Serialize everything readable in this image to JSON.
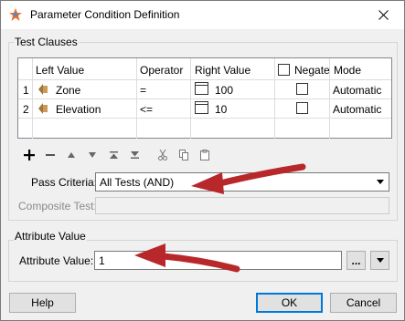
{
  "window": {
    "title": "Parameter Condition Definition"
  },
  "test_clauses": {
    "group_label": "Test Clauses",
    "columns": [
      "Left Value",
      "Operator",
      "Right Value",
      "Negate",
      "Mode"
    ],
    "rows": [
      {
        "num": "1",
        "left": "Zone",
        "operator": "=",
        "right": "100",
        "negate": false,
        "mode": "Automatic"
      },
      {
        "num": "2",
        "left": "Elevation",
        "operator": "<=",
        "right": "10",
        "negate": false,
        "mode": "Automatic"
      }
    ]
  },
  "toolbar": {
    "icons": [
      "add-icon",
      "remove-icon",
      "move-up-icon",
      "move-down-icon",
      "move-top-icon",
      "move-bottom-icon",
      "cut-icon",
      "copy-icon",
      "paste-icon"
    ]
  },
  "pass_criteria": {
    "label": "Pass Criteria:",
    "value": "All Tests (AND)"
  },
  "composite_test": {
    "label": "Composite Test:",
    "value": ""
  },
  "attribute_value": {
    "group_label": "Attribute Value",
    "label": "Attribute Value:",
    "value": "1",
    "ellipsis_label": "..."
  },
  "buttons": {
    "help": "Help",
    "ok": "OK",
    "cancel": "Cancel"
  },
  "colors": {
    "annotation_arrow": "#b8282b",
    "accent": "#0078d7"
  }
}
